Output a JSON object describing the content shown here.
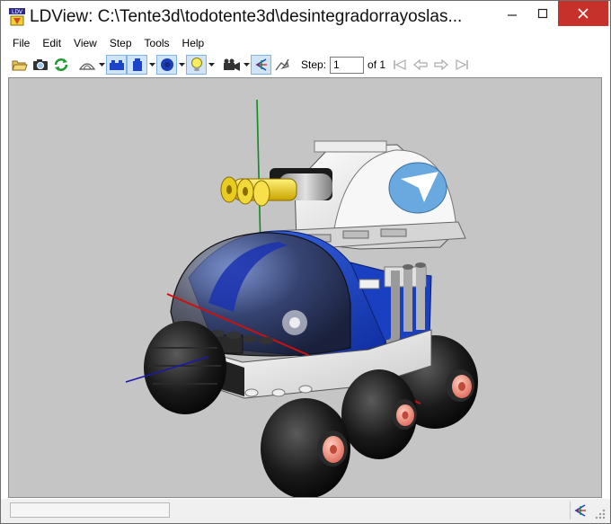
{
  "window": {
    "title": "LDView: C:\\Tente3d\\todotente3d\\desintegradorrayoslas..."
  },
  "menu": {
    "items": [
      "File",
      "Edit",
      "View",
      "Step",
      "Tools",
      "Help"
    ]
  },
  "toolbar": {
    "step_label": "Step:",
    "step_value": "1",
    "of_label": "of 1"
  },
  "icons": {
    "app": "ldview-logo-icon",
    "open": "folder-open-icon",
    "snapshot": "camera-icon",
    "reload": "refresh-icon",
    "wireframe": "wireframe-icon",
    "bricks": "brick-icon",
    "part": "part-icon",
    "primitives": "sphere-icon",
    "lighting": "lightbulb-icon",
    "view_angle": "video-camera-icon",
    "examine": "examine-mode-icon",
    "fly": "fly-mode-icon",
    "first_step": "first-step-icon",
    "prev_step": "prev-step-icon",
    "next_step": "next-step-icon",
    "last_step": "last-step-icon"
  },
  "colors": {
    "viewport_bg": "#c5c5c5",
    "close_button": "#c7312c",
    "accent_blue": "#1c44c8",
    "axis_x": "#cc1111",
    "axis_y": "#0f8a1e",
    "axis_z": "#1a1aa8"
  }
}
